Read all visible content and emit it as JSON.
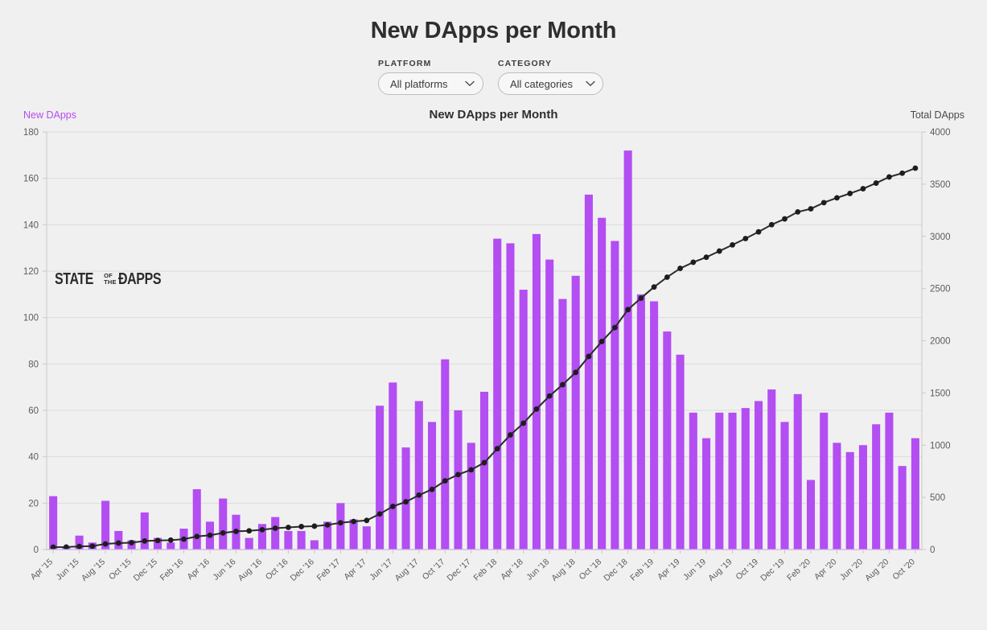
{
  "header": {
    "title": "New DApps per Month"
  },
  "filters": {
    "platform": {
      "label": "PLATFORM",
      "value": "All platforms",
      "icon": "chevron-down-icon"
    },
    "category": {
      "label": "CATEGORY",
      "value": "All categories",
      "icon": "chevron-down-icon"
    }
  },
  "chart": {
    "legend_left": "New DApps",
    "legend_right": "Total DApps",
    "subtitle": "New DApps per Month",
    "watermark": {
      "part1": "STATE",
      "part2a": "OF",
      "part2b": "THE",
      "part3": "ĐAPPS"
    },
    "colors": {
      "bar": "#b34ef2",
      "line": "#2b2b2b",
      "legend_left": "#b44cf0",
      "background": "#f0f0f0",
      "grid": "#dcdcdc"
    }
  },
  "chart_data": {
    "type": "bar",
    "title": "New DApps per Month",
    "xlabel": "",
    "ylabel": "New DApps",
    "ylabel_right": "Total DApps",
    "ylim": [
      0,
      180
    ],
    "ylim_right": [
      0,
      4000
    ],
    "yticks": [
      0,
      20,
      40,
      60,
      80,
      100,
      120,
      140,
      160,
      180
    ],
    "yticks_right": [
      0,
      500,
      1000,
      1500,
      2000,
      2500,
      3000,
      3500,
      4000
    ],
    "grid": true,
    "legend_position": "top-outside",
    "categories": [
      "Apr '15",
      "May '15",
      "Jun '15",
      "Jul '15",
      "Aug '15",
      "Sep '15",
      "Oct '15",
      "Nov '15",
      "Dec '15",
      "Jan '16",
      "Feb '16",
      "Mar '16",
      "Apr '16",
      "May '16",
      "Jun '16",
      "Jul '16",
      "Aug '16",
      "Sep '16",
      "Oct '16",
      "Nov '16",
      "Dec '16",
      "Jan '17",
      "Feb '17",
      "Mar '17",
      "Apr '17",
      "May '17",
      "Jun '17",
      "Jul '17",
      "Aug '17",
      "Sep '17",
      "Oct '17",
      "Nov '17",
      "Dec '17",
      "Jan '18",
      "Feb '18",
      "Mar '18",
      "Apr '18",
      "May '18",
      "Jun '18",
      "Jul '18",
      "Aug '18",
      "Sep '18",
      "Oct '18",
      "Nov '18",
      "Dec '18",
      "Jan '19",
      "Feb '19",
      "Mar '19",
      "Apr '19",
      "May '19",
      "Jun '19",
      "Jul '19",
      "Aug '19",
      "Sep '19",
      "Oct '19",
      "Nov '19",
      "Dec '19",
      "Jan '20",
      "Feb '20",
      "Mar '20",
      "Apr '20",
      "May '20",
      "Jun '20",
      "Jul '20",
      "Aug '20",
      "Sep '20",
      "Oct '20"
    ],
    "xtick_labels": [
      "Apr '15",
      "Jun '15",
      "Aug '15",
      "Oct '15",
      "Dec '15",
      "Feb '16",
      "Apr '16",
      "Jun '16",
      "Aug '16",
      "Oct '16",
      "Dec '16",
      "Feb '17",
      "Apr '17",
      "Jun '17",
      "Aug '17",
      "Oct '17",
      "Dec '17",
      "Feb '18",
      "Apr '18",
      "Jun '18",
      "Aug '18",
      "Oct '18",
      "Dec '18",
      "Feb '19",
      "Apr '19",
      "Jun '19",
      "Aug '19",
      "Oct '19",
      "Dec '19",
      "Feb '20",
      "Apr '20",
      "Jun '20",
      "Aug '20",
      "Oct '20"
    ],
    "xtick_step": 2,
    "series": [
      {
        "name": "New DApps",
        "type": "bar",
        "axis": "left",
        "color": "#b34ef2",
        "values": [
          23,
          1,
          6,
          3,
          21,
          8,
          4,
          16,
          5,
          3,
          9,
          26,
          12,
          22,
          15,
          5,
          11,
          14,
          8,
          8,
          4,
          12,
          20,
          13,
          10,
          62,
          72,
          44,
          64,
          55,
          82,
          60,
          46,
          68,
          134,
          132,
          112,
          136,
          125,
          108,
          118,
          153,
          143,
          133,
          172,
          110,
          107,
          94,
          84,
          59,
          48,
          59,
          59,
          61,
          64,
          69,
          55,
          67,
          30,
          59,
          46,
          42,
          45,
          54,
          59,
          36,
          48
        ]
      },
      {
        "name": "Total DApps",
        "type": "line",
        "axis": "right",
        "color": "#2b2b2b",
        "values": [
          23,
          24,
          30,
          33,
          54,
          62,
          66,
          82,
          87,
          90,
          99,
          125,
          137,
          159,
          174,
          179,
          190,
          204,
          212,
          220,
          224,
          236,
          256,
          269,
          279,
          341,
          413,
          457,
          521,
          576,
          658,
          718,
          764,
          832,
          966,
          1098,
          1210,
          1346,
          1471,
          1579,
          1697,
          1850,
          1993,
          2126,
          2298,
          2408,
          2515,
          2609,
          2693,
          2752,
          2800,
          2859,
          2918,
          2979,
          3043,
          3112,
          3167,
          3234,
          3264,
          3323,
          3369,
          3411,
          3456,
          3510,
          3569,
          3605,
          3653
        ]
      }
    ]
  }
}
